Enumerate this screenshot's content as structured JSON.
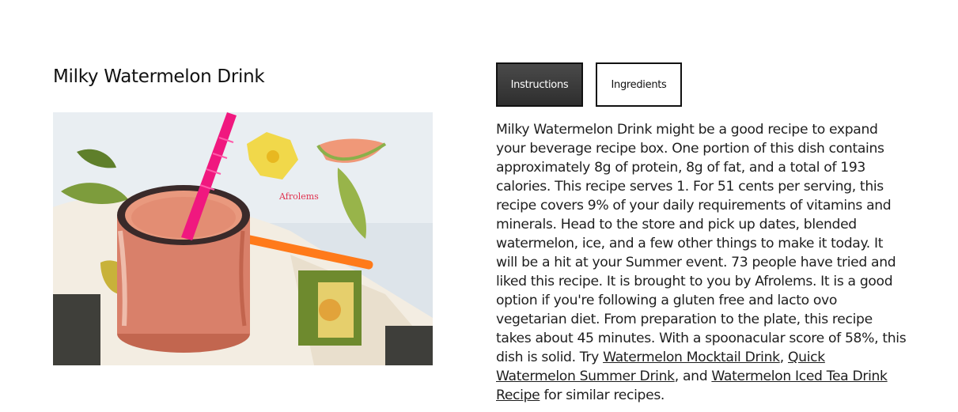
{
  "recipe": {
    "title": "Milky Watermelon Drink",
    "image_watermark": "Afrolems"
  },
  "tabs": [
    {
      "label": "Instructions",
      "active": true
    },
    {
      "label": "Ingredients",
      "active": false
    }
  ],
  "summary": {
    "intro": "Milky Watermelon Drink might be a good recipe to expand your beverage recipe box. One portion of this dish contains approximately 8g of protein, 8g of fat, and a total of 193 calories. This recipe serves 1. For 51 cents per serving, this recipe covers 9% of your daily requirements of vitamins and minerals. Head to the store and pick up dates, blended watermelon, ice, and a few other things to make it today. It will be a hit at your Summer event. 73 people have tried and liked this recipe. It is brought to you by Afrolems. It is a good option if you're following a gluten free and lacto ovo vegetarian diet. From preparation to the plate, this recipe takes about 45 minutes. With a spoonacular score of 58%, this dish is solid. Try ",
    "links": [
      "Watermelon Mocktail Drink",
      "Quick Watermelon Summer Drink",
      "Watermelon Iced Tea Drink Recipe"
    ],
    "sep_1": ", ",
    "sep_2": ", and ",
    "outro": " for similar recipes."
  },
  "colors": {
    "active_tab_bg": "#3a3a3a",
    "straw_pink": "#f0187f",
    "straw_orange": "#ff7a1a",
    "drink": "#e48a72"
  }
}
